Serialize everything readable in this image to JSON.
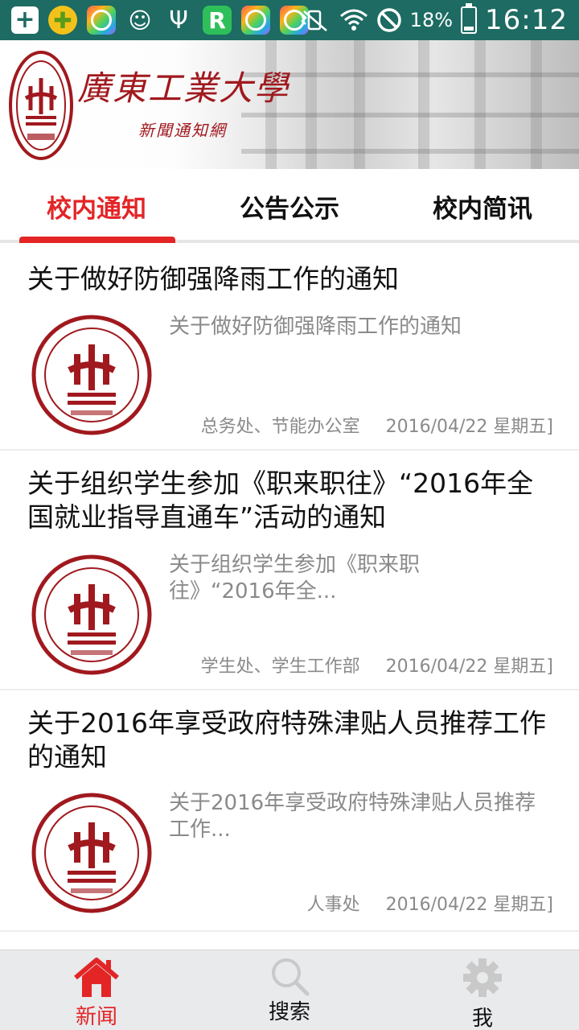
{
  "status_bar": {
    "battery_percent": "18%",
    "time": "16:12",
    "left_icons": [
      "add-box-icon",
      "game-center-icon",
      "app-market-icon",
      "face-icon",
      "usb-icon",
      "r-app-icon",
      "app-market-icon",
      "app-market-icon"
    ],
    "right_icons": [
      "vibrate-mute-icon",
      "wifi-icon",
      "do-not-disturb-icon",
      "battery-charging-icon"
    ]
  },
  "banner": {
    "school_name": "廣東工業大學",
    "subtitle": "新聞通知網",
    "accent": "#a0191e"
  },
  "tabs": [
    {
      "label": "校内通知",
      "active": true
    },
    {
      "label": "公告公示",
      "active": false
    },
    {
      "label": "校内简讯",
      "active": false
    }
  ],
  "colors": {
    "accent": "#e32526",
    "status_bar": "#1d6b63",
    "meta_text": "#8a8a8a"
  },
  "news": [
    {
      "title": "关于做好防御强降雨工作的通知",
      "summary": "关于做好防御强降雨工作的通知",
      "department": "总务处、节能办公室",
      "date": "2016/04/22 星期五]"
    },
    {
      "title": "关于组织学生参加《职来职往》“2016年全国就业指导直通车”活动的通知",
      "summary": "关于组织学生参加《职来职往》“2016年全...",
      "department": "学生处、学生工作部",
      "date": "2016/04/22 星期五]"
    },
    {
      "title": "关于2016年享受政府特殊津贴人员推荐工作的通知",
      "summary": "关于2016年享受政府特殊津贴人员推荐工作...",
      "department": "人事处",
      "date": "2016/04/22 星期五]"
    }
  ],
  "bottom_nav": [
    {
      "label": "新闻",
      "icon": "home-icon",
      "active": true
    },
    {
      "label": "搜索",
      "icon": "search-icon",
      "active": false
    },
    {
      "label": "我",
      "icon": "gear-icon",
      "active": false
    }
  ]
}
